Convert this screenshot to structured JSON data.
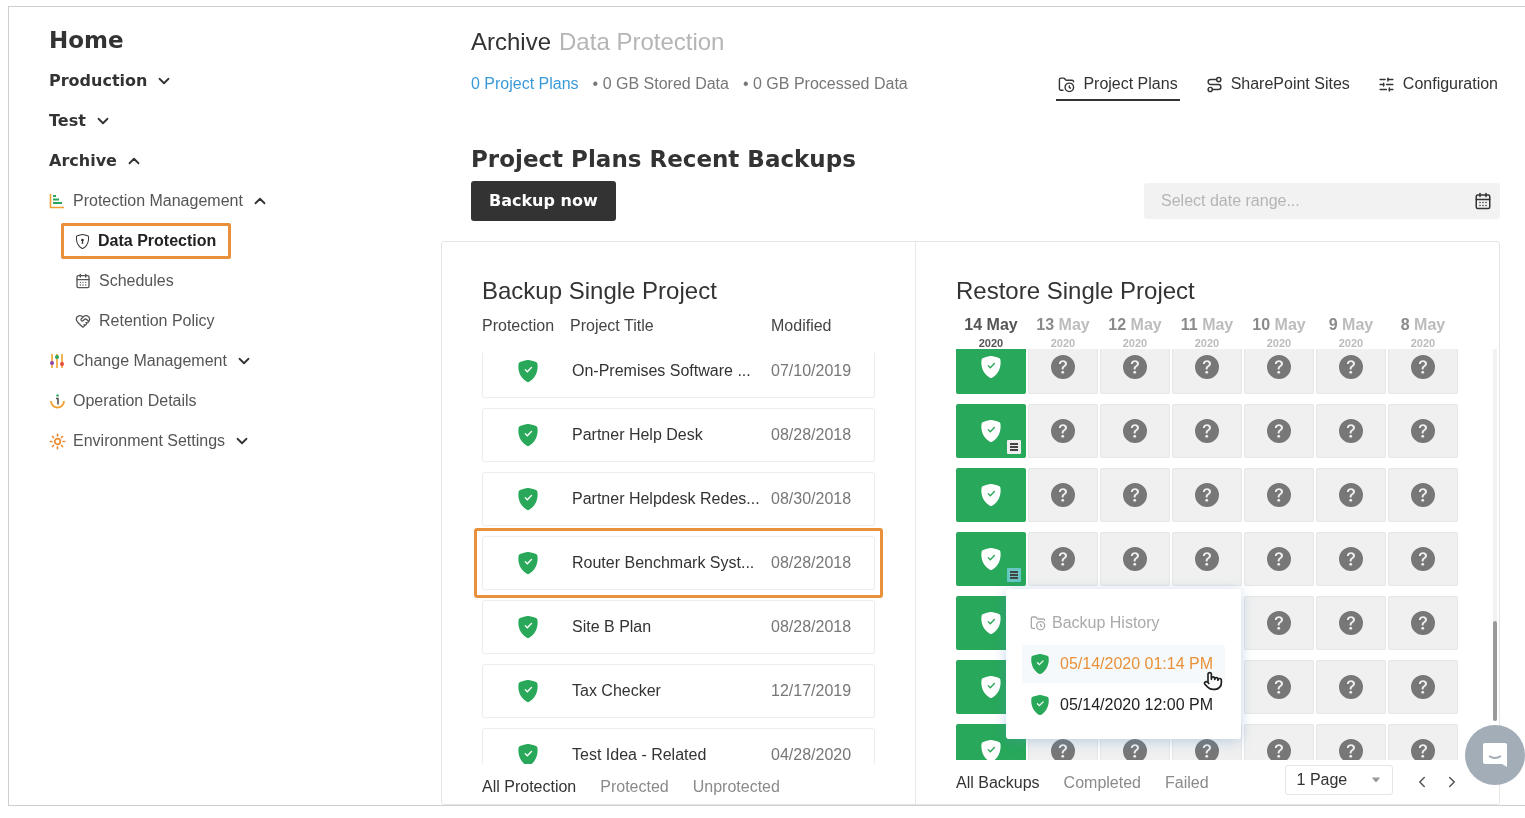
{
  "sidebar": {
    "title": "Home",
    "nav": [
      {
        "label": "Production",
        "expanded": false
      },
      {
        "label": "Test",
        "expanded": false
      },
      {
        "label": "Archive",
        "expanded": true,
        "children": [
          {
            "label": "Protection Management",
            "expanded": true,
            "children": [
              {
                "label": "Data Protection",
                "selected": true
              },
              {
                "label": "Schedules",
                "selected": false
              },
              {
                "label": "Retention Policy",
                "selected": false
              }
            ]
          },
          {
            "label": "Change Management",
            "expanded": false
          },
          {
            "label": "Operation Details"
          },
          {
            "label": "Environment Settings",
            "expanded": false
          }
        ]
      }
    ]
  },
  "header": {
    "section": "Archive",
    "page": "Data Protection",
    "stats_link": "0 Project Plans",
    "stats": [
      "• 0 GB Stored Data",
      "• 0 GB Processed Data"
    ],
    "tabs": [
      {
        "label": "Project Plans",
        "selected": true
      },
      {
        "label": "SharePoint Sites",
        "selected": false
      },
      {
        "label": "Configuration",
        "selected": false
      }
    ]
  },
  "heading": "Project Plans Recent Backups",
  "backup_button": "Backup now",
  "date_range": {
    "placeholder": "Select date range..."
  },
  "backup_panel": {
    "title": "Backup Single Project",
    "columns": [
      "Protection",
      "Project Title",
      "Modified"
    ],
    "rows": [
      {
        "title": "On-Premises Software ...",
        "modified": "07/10/2019",
        "protected": true,
        "selected": false
      },
      {
        "title": "Partner Help Desk",
        "modified": "08/28/2018",
        "protected": true,
        "selected": false
      },
      {
        "title": "Partner Helpdesk Redes...",
        "modified": "08/30/2018",
        "protected": true,
        "selected": false
      },
      {
        "title": "Router Benchmark Syst...",
        "modified": "08/28/2018",
        "protected": true,
        "selected": true
      },
      {
        "title": "Site B Plan",
        "modified": "08/28/2018",
        "protected": true,
        "selected": false
      },
      {
        "title": "Tax Checker",
        "modified": "12/17/2019",
        "protected": true,
        "selected": false
      },
      {
        "title": "Test Idea - Related",
        "modified": "04/28/2020",
        "protected": true,
        "selected": false
      }
    ],
    "filters": [
      {
        "label": "All Protection",
        "selected": true
      },
      {
        "label": "Protected",
        "selected": false
      },
      {
        "label": "Unprotected",
        "selected": false
      }
    ]
  },
  "restore_panel": {
    "title": "Restore Single Project",
    "dates": [
      {
        "day": "14",
        "month": "May",
        "year": "2020",
        "selected": true
      },
      {
        "day": "13",
        "month": "May",
        "year": "2020",
        "selected": false
      },
      {
        "day": "12",
        "month": "May",
        "year": "2020",
        "selected": false
      },
      {
        "day": "11",
        "month": "May",
        "year": "2020",
        "selected": false
      },
      {
        "day": "10",
        "month": "May",
        "year": "2020",
        "selected": false
      },
      {
        "day": "9",
        "month": "May",
        "year": "2020",
        "selected": false
      },
      {
        "day": "8",
        "month": "May",
        "year": "2020",
        "selected": false
      }
    ],
    "rows": [
      {
        "note": false,
        "cells": [
          {
            "kind": "backup"
          },
          {
            "kind": "unknown"
          },
          {
            "kind": "unknown"
          },
          {
            "kind": "unknown"
          },
          {
            "kind": "unknown"
          },
          {
            "kind": "unknown"
          },
          {
            "kind": "unknown"
          }
        ]
      },
      {
        "note": true,
        "note_selected": false,
        "cells": [
          {
            "kind": "backup"
          },
          {
            "kind": "unknown"
          },
          {
            "kind": "unknown"
          },
          {
            "kind": "unknown"
          },
          {
            "kind": "unknown"
          },
          {
            "kind": "unknown"
          },
          {
            "kind": "unknown"
          }
        ]
      },
      {
        "note": false,
        "cells": [
          {
            "kind": "backup"
          },
          {
            "kind": "unknown"
          },
          {
            "kind": "unknown"
          },
          {
            "kind": "unknown"
          },
          {
            "kind": "unknown"
          },
          {
            "kind": "unknown"
          },
          {
            "kind": "unknown"
          }
        ]
      },
      {
        "note": true,
        "note_selected": true,
        "cells": [
          {
            "kind": "backup"
          },
          {
            "kind": "unknown"
          },
          {
            "kind": "unknown"
          },
          {
            "kind": "unknown"
          },
          {
            "kind": "unknown"
          },
          {
            "kind": "unknown"
          },
          {
            "kind": "unknown"
          }
        ]
      },
      {
        "cells": [
          {
            "kind": "backup"
          },
          {
            "kind": "covered"
          },
          {
            "kind": "covered"
          },
          {
            "kind": "covered"
          },
          {
            "kind": "unknown"
          },
          {
            "kind": "unknown"
          },
          {
            "kind": "unknown"
          }
        ]
      },
      {
        "cells": [
          {
            "kind": "backup"
          },
          {
            "kind": "covered"
          },
          {
            "kind": "covered"
          },
          {
            "kind": "covered"
          },
          {
            "kind": "unknown"
          },
          {
            "kind": "unknown"
          },
          {
            "kind": "unknown"
          }
        ]
      },
      {
        "cells": [
          {
            "kind": "backup"
          },
          {
            "kind": "unknown"
          },
          {
            "kind": "unknown"
          },
          {
            "kind": "unknown"
          },
          {
            "kind": "unknown"
          },
          {
            "kind": "unknown"
          },
          {
            "kind": "unknown"
          }
        ]
      }
    ],
    "history": {
      "title": "Backup History",
      "entries": [
        {
          "time": "05/14/2020 01:14 PM",
          "selected": true
        },
        {
          "time": "05/14/2020 12:00 PM",
          "selected": false
        }
      ]
    },
    "filters": [
      {
        "label": "All Backups",
        "selected": true
      },
      {
        "label": "Completed",
        "selected": false
      },
      {
        "label": "Failed",
        "selected": false
      }
    ],
    "page_select": "1 Page"
  }
}
